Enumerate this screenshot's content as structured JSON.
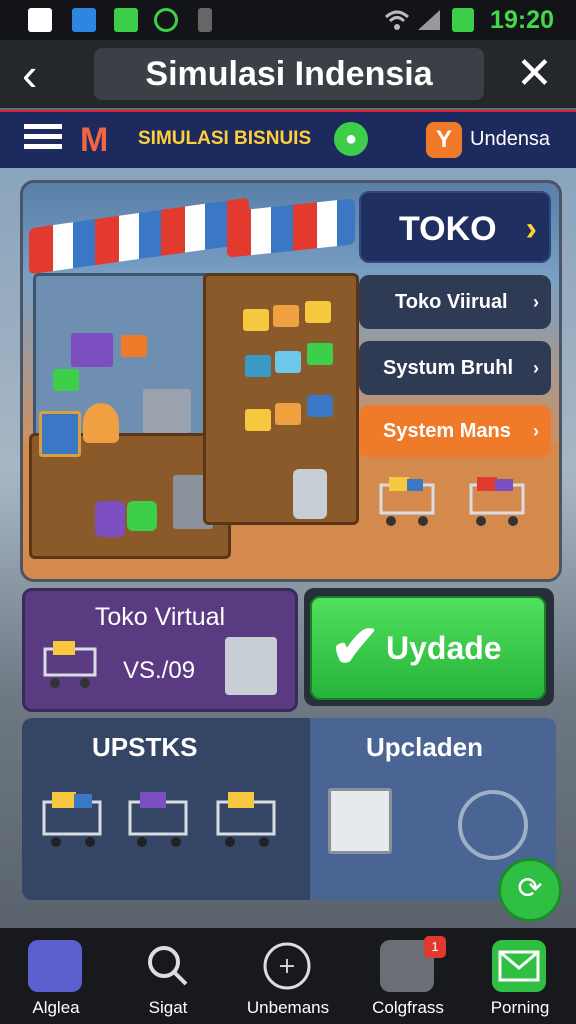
{
  "status_bar": {
    "time": "19:20"
  },
  "title_bar": {
    "title": "Simulasi Indensia",
    "back_icon": "back-arrow-icon",
    "close_icon": "close-icon"
  },
  "nav": {
    "brand": "SIMULASI BISNUIS",
    "right_label": "Undensa",
    "logo_text": "M"
  },
  "side_menu": {
    "main_label": "TOKO",
    "items": [
      {
        "label": "Toko Viirual"
      },
      {
        "label": "Systum Bruhl"
      },
      {
        "label": "System Mans"
      }
    ]
  },
  "cards": {
    "toko_virtual": {
      "title": "Toko Virtual",
      "value": "VS./09"
    },
    "update_button": {
      "label": "Uydade"
    },
    "bottom_left": {
      "title": "UPSTKS"
    },
    "bottom_right": {
      "title": "Upcladen"
    }
  },
  "tabs": [
    {
      "label": "Alglea",
      "icon": "home-icon"
    },
    {
      "label": "Sigat",
      "icon": "search-icon"
    },
    {
      "label": "Unbemans",
      "icon": "compass-icon"
    },
    {
      "label": "Colgfrass",
      "icon": "inbox-icon",
      "badge": "1"
    },
    {
      "label": "Porning",
      "icon": "mail-icon"
    }
  ],
  "colors": {
    "accent_green": "#2ebf43",
    "brand_yellow": "#ffcf3a",
    "orange": "#ef7a2a",
    "navy": "#1f2f60",
    "purple": "#5a3b82"
  }
}
